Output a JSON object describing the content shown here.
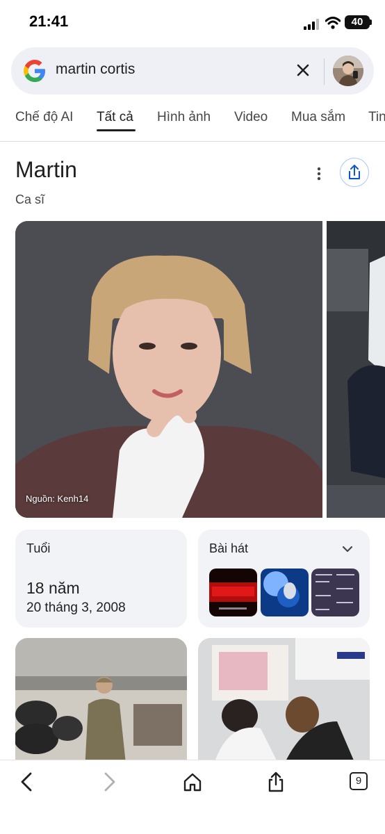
{
  "status_bar": {
    "time": "21:41",
    "battery": "40"
  },
  "search": {
    "query": "martin cortis"
  },
  "tabs": [
    {
      "label": "Chế độ AI"
    },
    {
      "label": "Tất cả"
    },
    {
      "label": "Hình ảnh"
    },
    {
      "label": "Video"
    },
    {
      "label": "Mua sắm"
    },
    {
      "label": "Tin"
    }
  ],
  "entity": {
    "title": "Martin",
    "subtitle": "Ca sĩ"
  },
  "image": {
    "source": "Nguồn: Kenh14"
  },
  "age_card": {
    "label": "Tuổi",
    "value": "18 năm",
    "birth_date": "20 tháng 3, 2008"
  },
  "songs_card": {
    "label": "Bài hát"
  },
  "bottom_nav": {
    "tab_count": "9"
  },
  "colors": {
    "accent_blue": "#4285f4",
    "google_red": "#ea4335",
    "google_yellow": "#fbbc05",
    "google_green": "#34a853"
  }
}
